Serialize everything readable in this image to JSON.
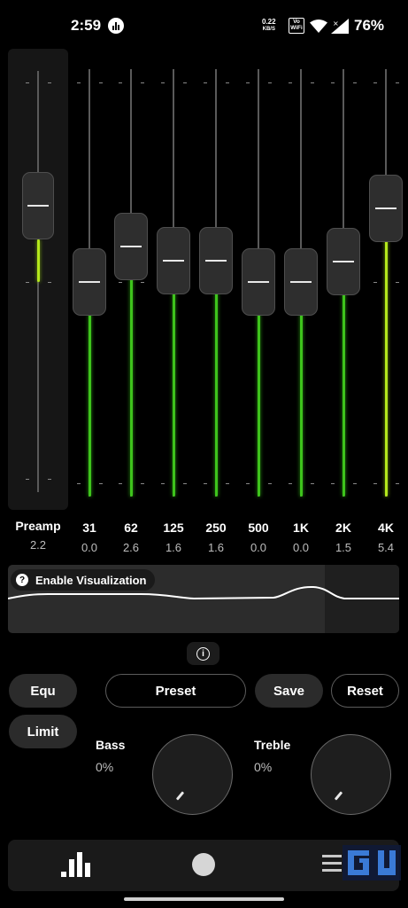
{
  "status_bar": {
    "time": "2:59",
    "net_speed": "0.22",
    "net_unit": "KB/S",
    "volte_top": "Vo",
    "volte_bottom": "WiFi",
    "battery": "76%"
  },
  "colors": {
    "background": "#000000",
    "slider_fill_green": "#3ec41c",
    "slider_fill_yellow": "#b4e81c",
    "knob": "#2e2e2e"
  },
  "preamp": {
    "label": "Preamp",
    "value": "2.2"
  },
  "bands": [
    {
      "label": "31",
      "value": "0.0"
    },
    {
      "label": "62",
      "value": "2.6"
    },
    {
      "label": "125",
      "value": "1.6"
    },
    {
      "label": "250",
      "value": "1.6"
    },
    {
      "label": "500",
      "value": "0.0"
    },
    {
      "label": "1K",
      "value": "0.0"
    },
    {
      "label": "2K",
      "value": "1.5"
    },
    {
      "label": "4K",
      "value": "5.4"
    }
  ],
  "visualization": {
    "toggle_label": "Enable Visualization"
  },
  "buttons": {
    "equ": "Equ",
    "limit": "Limit",
    "preset": "Preset",
    "save": "Save",
    "reset": "Reset"
  },
  "bass": {
    "label": "Bass",
    "value": "0%"
  },
  "treble": {
    "label": "Treble",
    "value": "0%"
  },
  "icons": {
    "status_app": "equalizer-app-icon",
    "wifi": "wifi-icon",
    "signal": "cell-signal-icon",
    "info": "info-icon",
    "help": "help-icon",
    "nav_equalizer": "equalizer-bars-icon",
    "nav_knob": "knob-icon",
    "nav_menu": "menu-icon"
  }
}
